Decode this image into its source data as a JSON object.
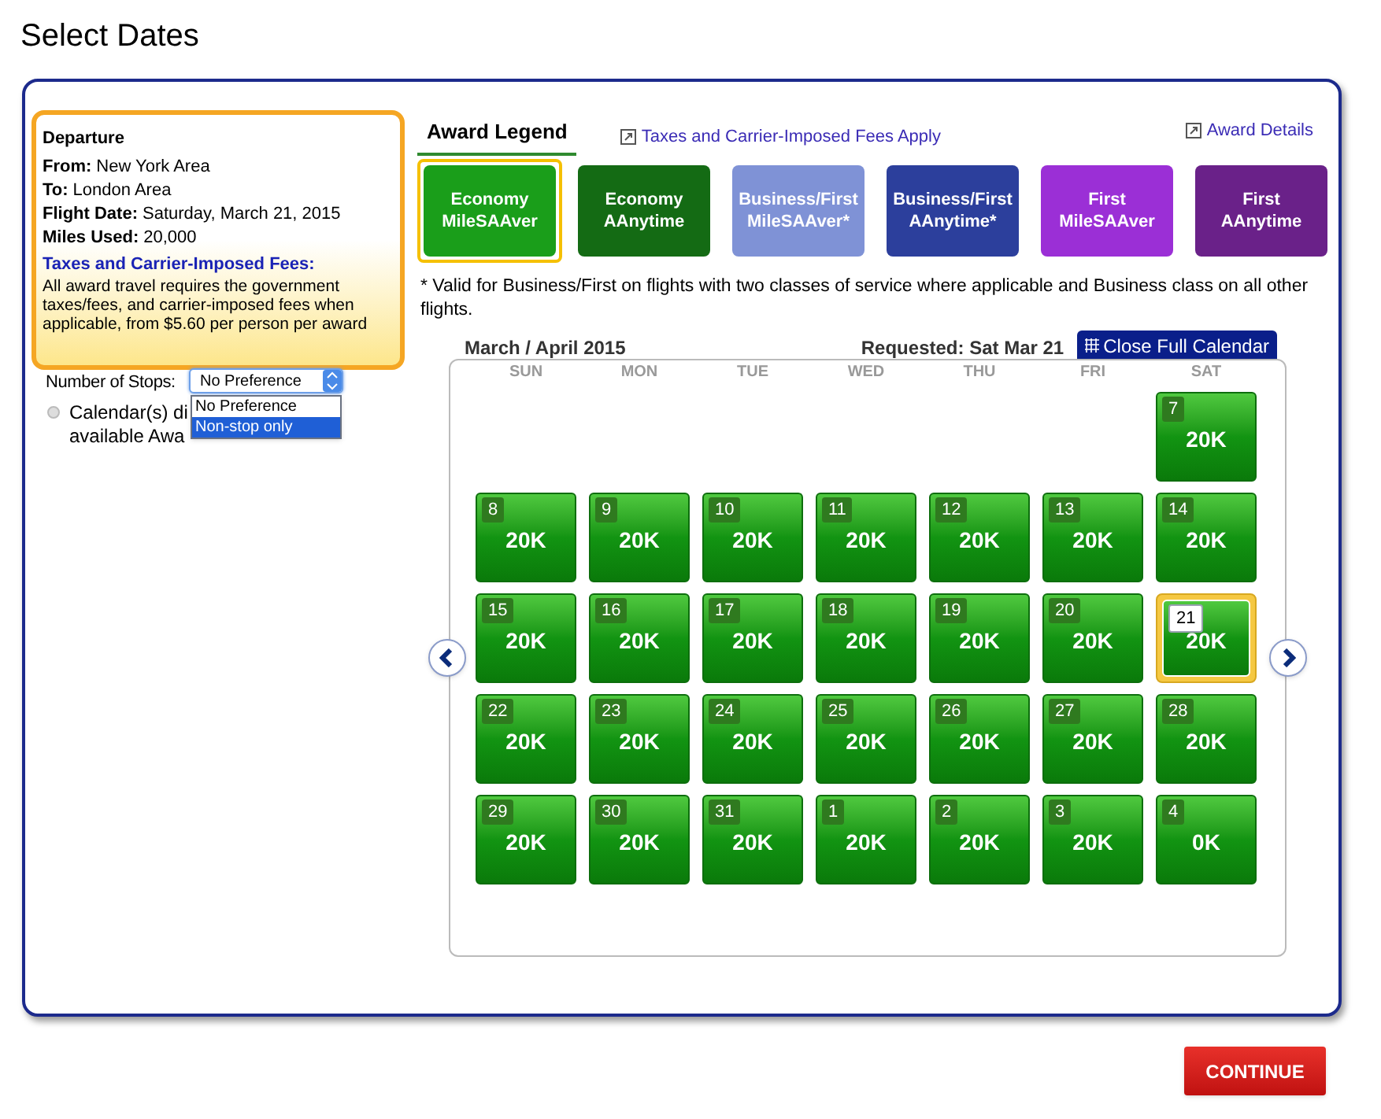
{
  "page_title": "Select Dates",
  "departure": {
    "heading": "Departure",
    "fields": [
      {
        "label": "From:",
        "value": "New York Area"
      },
      {
        "label": "To:",
        "value": "London Area"
      },
      {
        "label": "Flight Date:",
        "value": "Saturday, March 21, 2015"
      },
      {
        "label": "Miles Used:",
        "value": "20,000"
      }
    ],
    "fees_heading": "Taxes and Carrier-Imposed Fees:",
    "fees_text": "All award travel requires the government taxes/fees, and carrier-imposed fees when applicable, from $5.60 per person per award"
  },
  "stops": {
    "label": "Number of Stops:",
    "value": "No Preference",
    "options": [
      {
        "label": "No Preference",
        "highlighted": false
      },
      {
        "label": "Non-stop only",
        "highlighted": true
      }
    ]
  },
  "calendar_note": [
    "Calendar(s) di",
    "available Awa"
  ],
  "legend": {
    "title": "Award Legend",
    "fees_link": "Taxes and Carrier-Imposed Fees Apply",
    "details_link": "Award Details",
    "items": [
      {
        "line1": "Economy",
        "line2": "MileSAAver",
        "color": "#1a9e1a",
        "selected": true
      },
      {
        "line1": "Economy",
        "line2": "AAnytime",
        "color": "#146b14",
        "selected": false
      },
      {
        "line1": "Business/First",
        "line2": "MileSAAver*",
        "color": "#7f92d6",
        "selected": false
      },
      {
        "line1": "Business/First",
        "line2": "AAnytime*",
        "color": "#2c3f9c",
        "selected": false
      },
      {
        "line1": "First",
        "line2": "MileSAAver",
        "color": "#9b2fd6",
        "selected": false
      },
      {
        "line1": "First",
        "line2": "AAnytime",
        "color": "#6a2189",
        "selected": false
      }
    ],
    "footnote": "* Valid for Business/First on flights with two classes of service where applicable and Business class on all other flights."
  },
  "calendar": {
    "month": "March / April 2015",
    "requested": "Requested: Sat Mar 21",
    "close_button": "Close Full Calendar",
    "weekdays": [
      "SUN",
      "MON",
      "TUE",
      "WED",
      "THU",
      "FRI",
      "SAT"
    ],
    "weeks": [
      [
        {
          "kind": "blank"
        },
        {
          "kind": "blank"
        },
        {
          "kind": "blank"
        },
        {
          "kind": "blank"
        },
        {
          "kind": "blank"
        },
        {
          "kind": "blank"
        },
        {
          "day": "7",
          "miles": "20K",
          "selected": false
        }
      ],
      [
        {
          "day": "8",
          "miles": "20K",
          "selected": false
        },
        {
          "day": "9",
          "miles": "20K",
          "selected": false
        },
        {
          "day": "10",
          "miles": "20K",
          "selected": false
        },
        {
          "day": "11",
          "miles": "20K",
          "selected": false
        },
        {
          "day": "12",
          "miles": "20K",
          "selected": false
        },
        {
          "day": "13",
          "miles": "20K",
          "selected": false
        },
        {
          "day": "14",
          "miles": "20K",
          "selected": false
        }
      ],
      [
        {
          "day": "15",
          "miles": "20K",
          "selected": false
        },
        {
          "day": "16",
          "miles": "20K",
          "selected": false
        },
        {
          "day": "17",
          "miles": "20K",
          "selected": false
        },
        {
          "day": "18",
          "miles": "20K",
          "selected": false
        },
        {
          "day": "19",
          "miles": "20K",
          "selected": false
        },
        {
          "day": "20",
          "miles": "20K",
          "selected": false
        },
        {
          "day": "21",
          "miles": "20K",
          "selected": true
        }
      ],
      [
        {
          "day": "22",
          "miles": "20K",
          "selected": false
        },
        {
          "day": "23",
          "miles": "20K",
          "selected": false
        },
        {
          "day": "24",
          "miles": "20K",
          "selected": false
        },
        {
          "day": "25",
          "miles": "20K",
          "selected": false
        },
        {
          "day": "26",
          "miles": "20K",
          "selected": false
        },
        {
          "day": "27",
          "miles": "20K",
          "selected": false
        },
        {
          "day": "28",
          "miles": "20K",
          "selected": false
        }
      ],
      [
        {
          "day": "29",
          "miles": "20K",
          "selected": false
        },
        {
          "day": "30",
          "miles": "20K",
          "selected": false
        },
        {
          "day": "31",
          "miles": "20K",
          "selected": false
        },
        {
          "day": "1",
          "miles": "20K",
          "selected": false
        },
        {
          "day": "2",
          "miles": "20K",
          "selected": false
        },
        {
          "day": "3",
          "miles": "20K",
          "selected": false
        },
        {
          "day": "4",
          "miles": "0K",
          "selected": false
        }
      ]
    ]
  },
  "continue_button": "CONTINUE"
}
